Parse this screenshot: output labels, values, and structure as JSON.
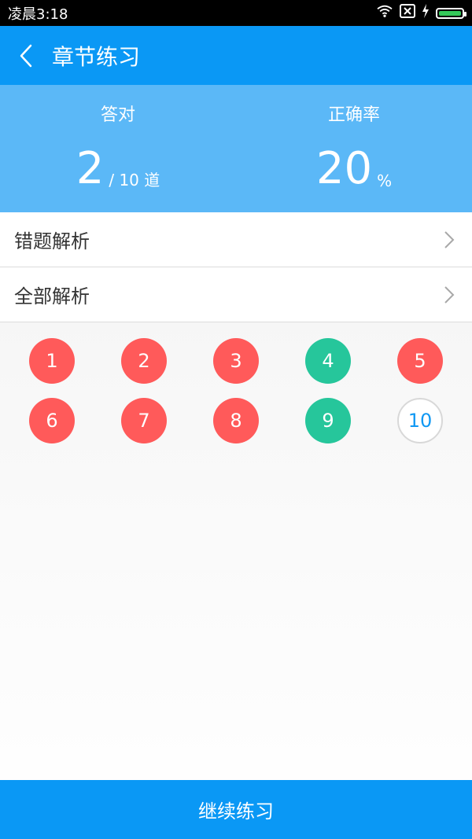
{
  "status_bar": {
    "time": "凌晨3:18",
    "icons": [
      "wifi-icon",
      "sim-off-icon",
      "charging-icon",
      "battery-icon"
    ],
    "battery_color": "#34c759"
  },
  "header": {
    "title": "章节练习",
    "back_icon": "chevron-left-icon",
    "color": "#0a98f5"
  },
  "stats": {
    "correct": {
      "label": "答对",
      "value": "2",
      "suffix": "/ 10 道"
    },
    "accuracy": {
      "label": "正确率",
      "value": "20",
      "suffix": "%"
    },
    "color": "#5bb8f7"
  },
  "list": [
    {
      "label": "错题解析",
      "icon": "chevron-right-icon"
    },
    {
      "label": "全部解析",
      "icon": "chevron-right-icon"
    }
  ],
  "questions": [
    {
      "number": "1",
      "state": "wrong"
    },
    {
      "number": "2",
      "state": "wrong"
    },
    {
      "number": "3",
      "state": "wrong"
    },
    {
      "number": "4",
      "state": "right"
    },
    {
      "number": "5",
      "state": "wrong"
    },
    {
      "number": "6",
      "state": "wrong"
    },
    {
      "number": "7",
      "state": "wrong"
    },
    {
      "number": "8",
      "state": "wrong"
    },
    {
      "number": "9",
      "state": "right"
    },
    {
      "number": "10",
      "state": "unanswered"
    }
  ],
  "colors": {
    "wrong": "#ff5a5a",
    "right": "#26c69b",
    "unanswered_text": "#1098f3"
  },
  "footer": {
    "button_label": "继续练习"
  }
}
